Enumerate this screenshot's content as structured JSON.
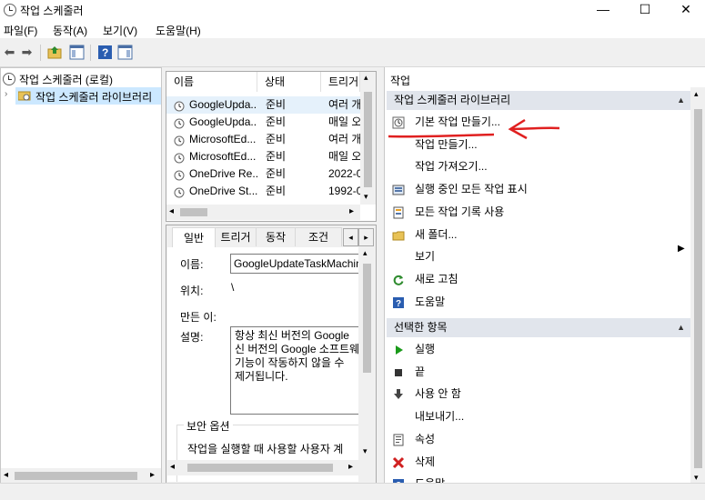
{
  "window": {
    "title": "작업 스케줄러"
  },
  "menu": [
    "파일(F)",
    "동작(A)",
    "보기(V)",
    "도움말(H)"
  ],
  "tree": {
    "root": "작업 스케줄러 (로컬)",
    "library": "작업 스케줄러 라이브러리"
  },
  "list": {
    "columns": [
      "이름",
      "상태",
      "트리거"
    ],
    "rows": [
      {
        "name": "GoogleUpda...",
        "status": "준비",
        "trigger": "여러 개"
      },
      {
        "name": "GoogleUpda...",
        "status": "준비",
        "trigger": "매일 오"
      },
      {
        "name": "MicrosoftEd...",
        "status": "준비",
        "trigger": "여러 개"
      },
      {
        "name": "MicrosoftEd...",
        "status": "준비",
        "trigger": "매일 오"
      },
      {
        "name": "OneDrive Re...",
        "status": "준비",
        "trigger": "2022-0"
      },
      {
        "name": "OneDrive St...",
        "status": "준비",
        "trigger": "1992-0"
      }
    ]
  },
  "detail": {
    "tabs": [
      "일반",
      "트리거",
      "동작",
      "조건"
    ],
    "name_label": "이름:",
    "name_value": "GoogleUpdateTaskMachin",
    "location_label": "위치:",
    "location_value": "\\",
    "author_label": "만든 이:",
    "desc_label": "설명:",
    "desc_lines": [
      "항상 최신 버전의 Google",
      "신 버전의 Google 소프트웨",
      "기능이 작동하지 않을 수",
      "제거됩니다."
    ],
    "security_group": "보안 옵션",
    "security_text": "작업을 실행할 때 사용할 사용자 계"
  },
  "actions": {
    "header": "작업",
    "section1": "작업 스케줄러 라이브러리",
    "items1": [
      {
        "label": "기본 작업 만들기...",
        "icon": "wizard-icon"
      },
      {
        "label": "작업 만들기...",
        "icon": "none"
      },
      {
        "label": "작업 가져오기...",
        "icon": "none"
      },
      {
        "label": "실행 중인 모든 작업 표시",
        "icon": "running-tasks-icon"
      },
      {
        "label": "모든 작업 기록 사용",
        "icon": "history-icon"
      },
      {
        "label": "새 폴더...",
        "icon": "folder-icon"
      },
      {
        "label": "보기",
        "icon": "none"
      },
      {
        "label": "새로 고침",
        "icon": "refresh-icon"
      },
      {
        "label": "도움말",
        "icon": "help-icon"
      }
    ],
    "section2": "선택한 항목",
    "items2": [
      {
        "label": "실행",
        "icon": "play-icon"
      },
      {
        "label": "끝",
        "icon": "stop-icon"
      },
      {
        "label": "사용 안 함",
        "icon": "disable-icon"
      },
      {
        "label": "내보내기...",
        "icon": "none"
      },
      {
        "label": "속성",
        "icon": "properties-icon"
      },
      {
        "label": "삭제",
        "icon": "delete-icon"
      },
      {
        "label": "도움말",
        "icon": "help-icon"
      }
    ]
  },
  "colors": {
    "annotation": "#e02020",
    "section_bg": "#e1e5ec",
    "selected_row": "#e5f1fb",
    "accent_blue": "#2a5db0"
  }
}
